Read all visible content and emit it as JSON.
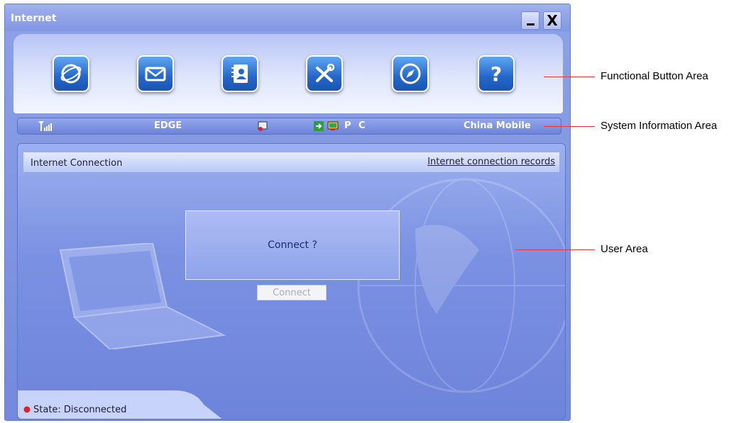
{
  "window": {
    "title": "Internet",
    "minimize_label": "_",
    "close_label": "X"
  },
  "functional_buttons": [
    {
      "icon": "internet-icon"
    },
    {
      "icon": "sms-icon"
    },
    {
      "icon": "contacts-icon"
    },
    {
      "icon": "settings-icon"
    },
    {
      "icon": "services-icon"
    },
    {
      "icon": "help-icon"
    }
  ],
  "system_info": {
    "network_type": "EDGE",
    "connection_target": "P C",
    "operator": "China Mobile"
  },
  "user_area": {
    "title": "Internet Connection",
    "records_link": "Internet connection records",
    "prompt": "Connect ?",
    "connect_button": "Connect",
    "state": "State: Disconnected"
  },
  "annotations": {
    "functional": "Functional Button Area",
    "system": "System Information Area",
    "user": "User Area"
  },
  "colors": {
    "window_bg": "#7489dd",
    "button_blue": "#2466c9",
    "annotation_line": "#e0393e",
    "state_indicator": "#d9232a"
  }
}
